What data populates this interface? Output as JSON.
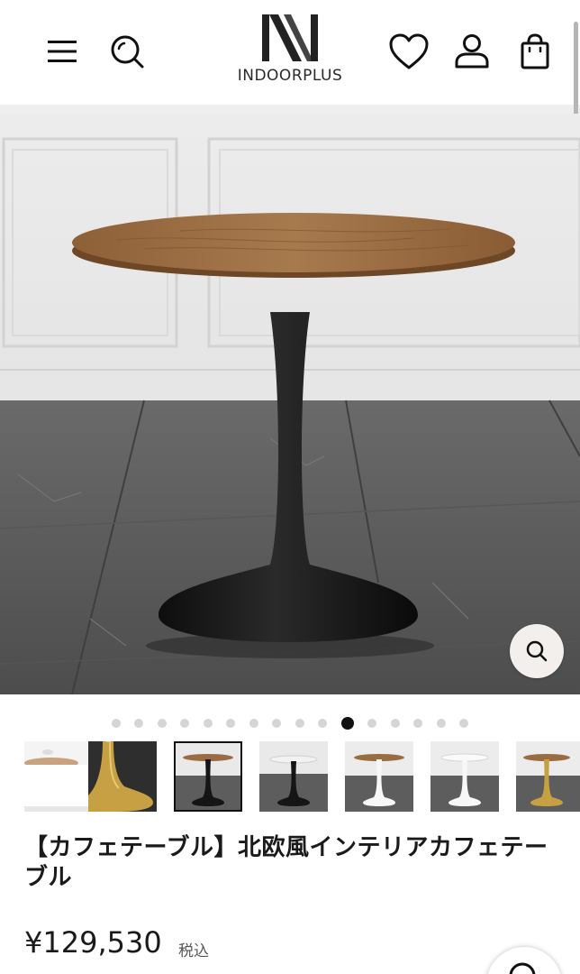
{
  "header": {
    "brand": "INDOORPLUS",
    "menu_icon": "hamburger-menu-icon",
    "search_icon": "search-icon",
    "wishlist_icon": "heart-icon",
    "account_icon": "user-icon",
    "cart_icon": "shopping-bag-icon"
  },
  "gallery": {
    "total_slides": 16,
    "active_slide": 11,
    "zoom_icon": "zoom-search-icon",
    "thumbnails": [
      {
        "variant": "white-table-partial"
      },
      {
        "variant": "gold-base"
      },
      {
        "variant": "wood-top-black-base"
      },
      {
        "variant": "white-top-black-base"
      },
      {
        "variant": "wood-top-white-base"
      },
      {
        "variant": "white-top-white-base"
      },
      {
        "variant": "wood-top-gold-base"
      }
    ]
  },
  "product": {
    "title": "【カフェテーブル】北欧風インテリアカフェテーブル",
    "price": "¥129,530",
    "tax_label": "税込"
  },
  "colors": {
    "wall": "#e9e9e9",
    "floor": "#5c5c5c",
    "wood": "#9a6c42",
    "base": "#151515",
    "active_dot": "#111111",
    "inactive_dot": "#d5d5d5"
  }
}
